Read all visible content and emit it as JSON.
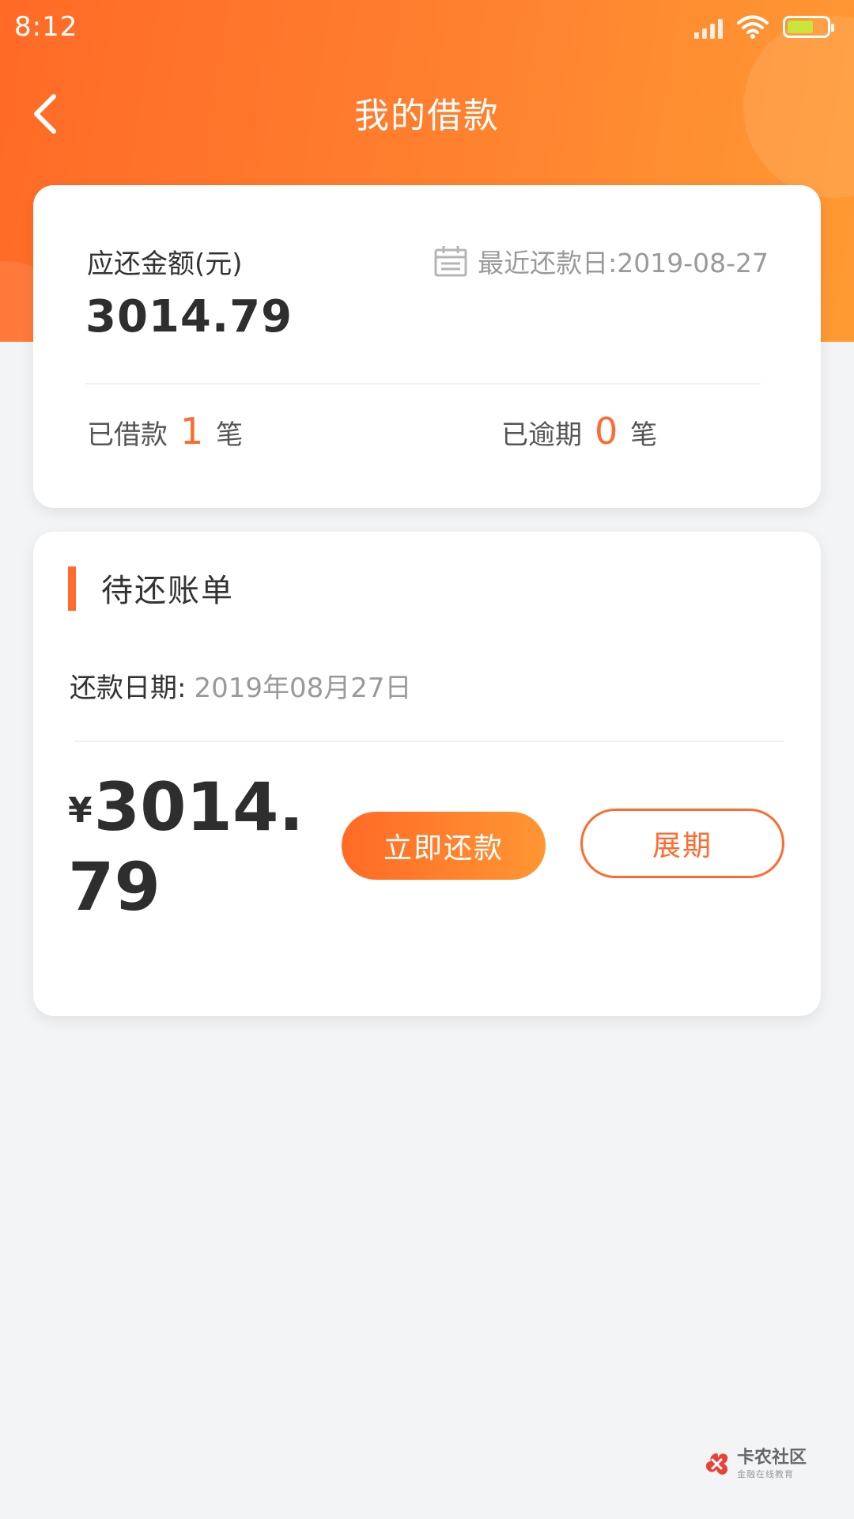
{
  "status_bar": {
    "time": "8:12"
  },
  "nav": {
    "title": "我的借款",
    "back_icon": "chevron-left-icon"
  },
  "summary": {
    "amount_label": "应还金额(元)",
    "amount": "3014.79",
    "recent_due_label": "最近还款日:2019-08-27",
    "borrowed_prefix": "已借款",
    "borrowed_count": "1",
    "borrowed_suffix": "笔",
    "overdue_prefix": "已逾期",
    "overdue_count": "0",
    "overdue_suffix": "笔"
  },
  "bill": {
    "title": "待还账单",
    "due_date_label": "还款日期:",
    "due_date_value": "2019年08月27日",
    "currency_symbol": "¥",
    "amount": "3014.79",
    "repay_button": "立即还款",
    "extend_button": "展期"
  },
  "watermark": {
    "name": "卡农社区",
    "tagline": "金融在线教育"
  },
  "colors": {
    "accent": "#ff6a2f",
    "header_gradient_start": "#ff6a26",
    "header_gradient_end": "#ff9a33",
    "background": "#f3f4f5"
  }
}
